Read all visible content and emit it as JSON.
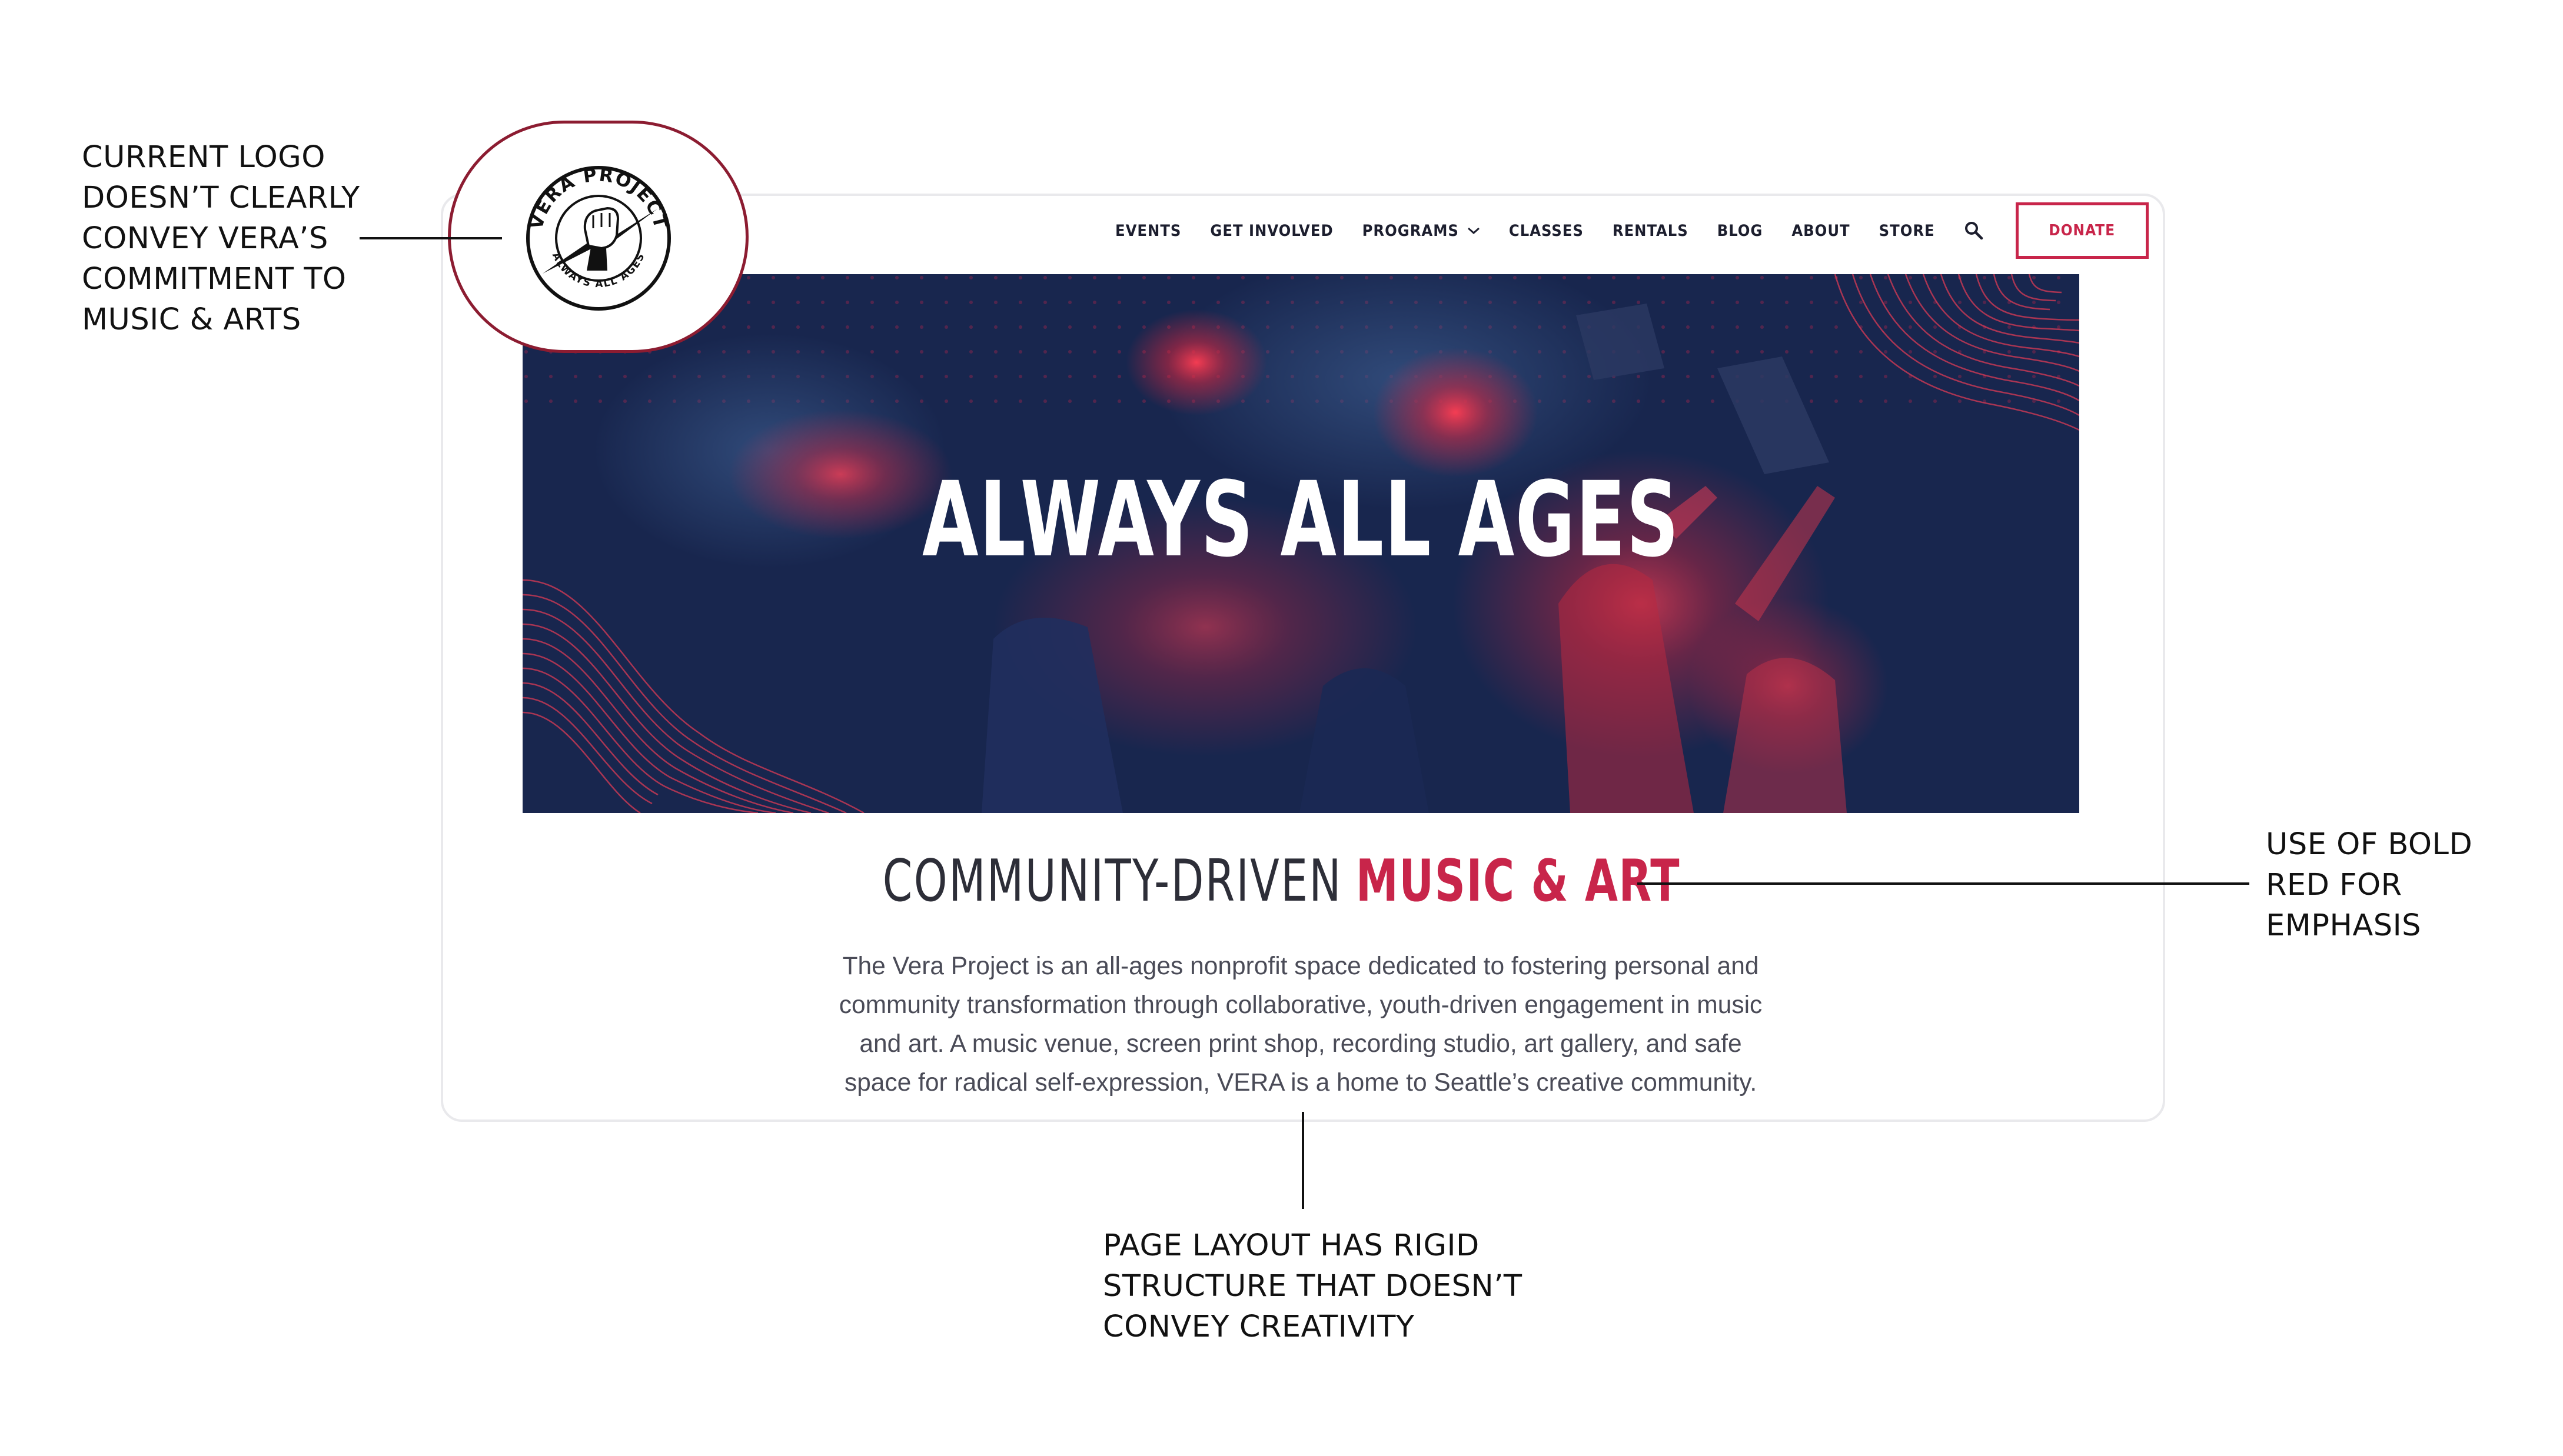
{
  "nav": {
    "items": [
      {
        "label": "EVENTS"
      },
      {
        "label": "GET INVOLVED"
      },
      {
        "label": "PROGRAMS",
        "has_dropdown": true
      },
      {
        "label": "CLASSES"
      },
      {
        "label": "RENTALS"
      },
      {
        "label": "BLOG"
      },
      {
        "label": "ABOUT"
      },
      {
        "label": "STORE"
      }
    ],
    "search_icon": "search-icon",
    "donate_label": "DONATE"
  },
  "logo": {
    "top_text": "VERA PROJECT",
    "bottom_text": "ALWAYS ALL AGES"
  },
  "hero": {
    "title": "ALWAYS ALL AGES"
  },
  "headline": {
    "light": "COMMUNITY-DRIVEN",
    "bold": "MUSIC & ART"
  },
  "intro": {
    "lines": [
      "The Vera Project is an all-ages nonprofit space dedicated to fostering personal and",
      "community transformation through collaborative, youth-driven engagement in music",
      "and art. A music venue, screen print shop, recording studio, art gallery, and safe",
      "space for radical self-expression, VERA is a home to Seattle’s creative community."
    ]
  },
  "annotations": {
    "logo_note": [
      "CURRENT LOGO",
      "DOESN’T CLEARLY",
      "CONVEY VERA’S",
      "COMMITMENT TO",
      "MUSIC & ARTS"
    ],
    "red_note": [
      "USE OF BOLD",
      "RED FOR",
      "EMPHASIS"
    ],
    "layout_note": [
      "PAGE LAYOUT HAS RIGID",
      "STRUCTURE THAT DOESN’T",
      "CONVEY CREATIVITY"
    ]
  },
  "colors": {
    "accent_red": "#c8254a",
    "hero_navy": "#18264e",
    "bubble_outline": "#8c1c31",
    "text_dark": "#1c1e2e"
  }
}
